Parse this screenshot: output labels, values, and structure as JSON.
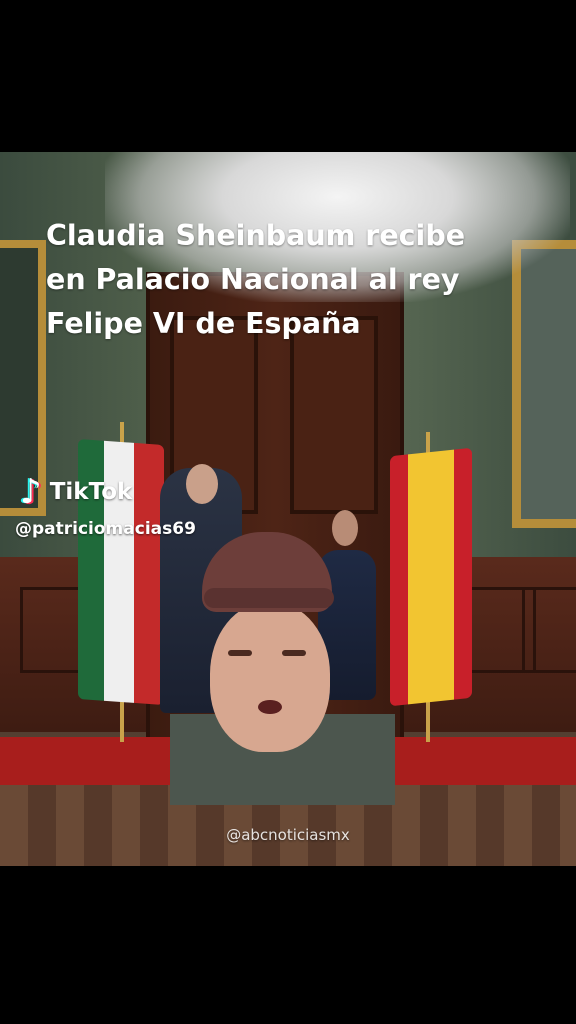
{
  "video": {
    "title": "Claudia Sheinbaum recibe en Palacio Nacional al rey Felipe VI de España",
    "source_watermark": "@abcnoticiasmx"
  },
  "branding": {
    "app_name": "TikTok",
    "logo_icon": "tiktok-note-icon",
    "creator_handle": "@patriciomacias69"
  },
  "colors": {
    "background": "#000000",
    "tiktok_cyan": "#25f4ee",
    "tiktok_red": "#fe2c55"
  }
}
